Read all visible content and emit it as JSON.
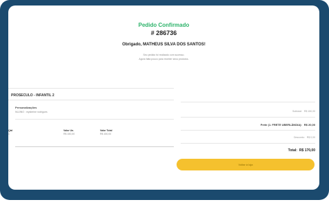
{
  "header": {
    "title": "Pedido Confirmado",
    "order_number": "# 286736",
    "thanks": "Obrigado, MATHEUS SILVA DOS SANTOS!",
    "subtitle_line1": "Seu pedido foi realizado com sucesso.",
    "subtitle_line2": "Agora falta pouco para receber seus produtos."
  },
  "product": {
    "title": "PROSECULO - INFANTIL 2",
    "personalization_label": "Personalizações",
    "personalization_text": "NUJINO : mysterine rodrigues",
    "columns": {
      "qty_label": "Qtd",
      "unit_label": "Valor Un.",
      "total_label": "Valor Total"
    },
    "values": {
      "qty": "1",
      "unit": "R$ 150,00",
      "total": "R$ 150,00"
    }
  },
  "totals": {
    "subtotal_label": "Subtotal:",
    "subtotal_value": "R$ 150,00",
    "frete_label": "Frete (1. FRETE UBERLÂNDIA):",
    "frete_value": "R$ 20,00",
    "desconto_label": "Desconto:",
    "desconto_value": "R$ 0,00",
    "total_label": "Total:",
    "total_value": "R$ 170,00"
  },
  "actions": {
    "primary_label": "Voltar à loja"
  },
  "colors": {
    "frame": "#1b4a6e",
    "accent": "#2db36a",
    "button": "#f5c12e"
  }
}
